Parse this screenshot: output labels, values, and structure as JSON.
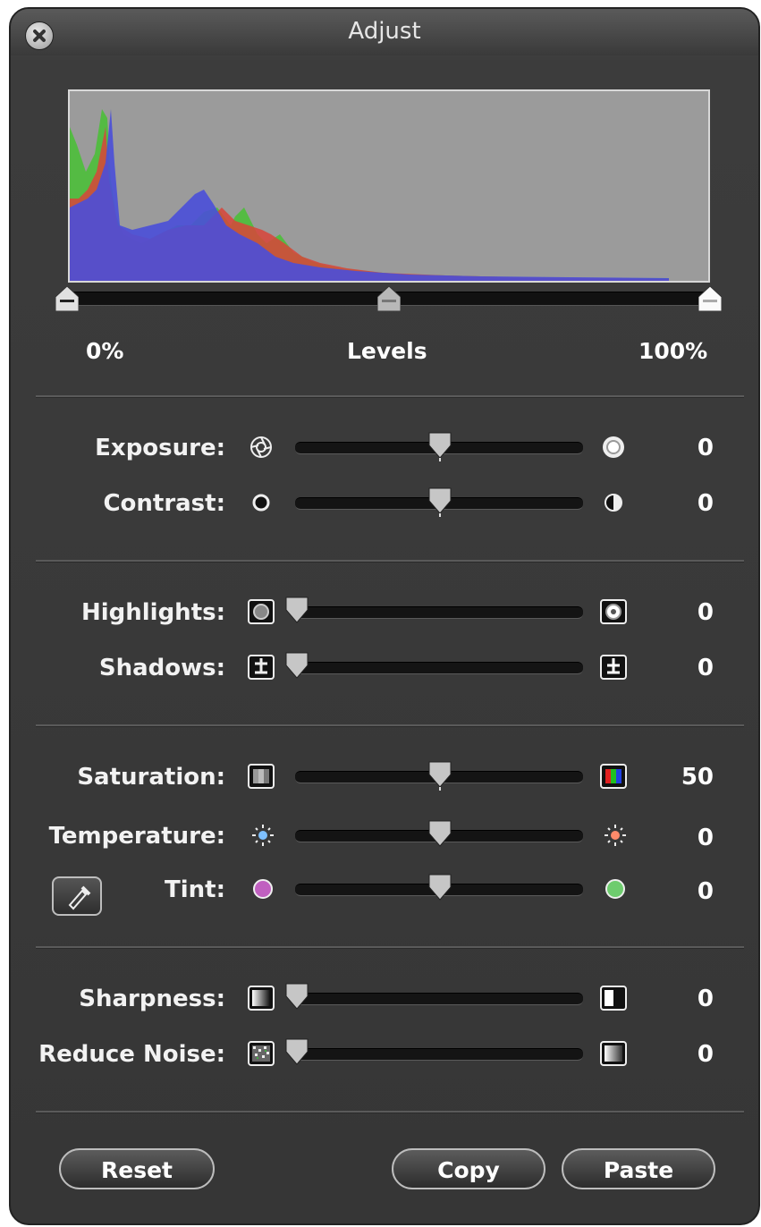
{
  "window": {
    "title": "Adjust"
  },
  "levels": {
    "min_label": "0%",
    "label": "Levels",
    "max_label": "100%",
    "black_point": 0,
    "gray_point": 0.5,
    "white_point": 1
  },
  "sliders": [
    {
      "label": "Exposure:",
      "value": "0",
      "position": 0.5,
      "left_icon": "aperture-icon",
      "right_icon": "bright-aperture-icon"
    },
    {
      "label": "Contrast:",
      "value": "0",
      "position": 0.5,
      "left_icon": "dot-icon",
      "right_icon": "half-circle-icon"
    },
    {
      "label": "Highlights:",
      "value": "0",
      "position": 0,
      "left_icon": "highlights-low-icon",
      "right_icon": "highlights-high-icon"
    },
    {
      "label": "Shadows:",
      "value": "0",
      "position": 0,
      "left_icon": "shadows-low-icon",
      "right_icon": "shadows-high-icon"
    },
    {
      "label": "Saturation:",
      "value": "50",
      "position": 0.5,
      "left_icon": "gray-swatch-icon",
      "right_icon": "rgb-swatch-icon"
    },
    {
      "label": "Temperature:",
      "value": "0",
      "position": 0.5,
      "left_icon": "cool-sun-icon",
      "right_icon": "warm-sun-icon"
    },
    {
      "label": "Tint:",
      "value": "0",
      "position": 0.5,
      "left_icon": "magenta-dot-icon",
      "right_icon": "green-dot-icon"
    },
    {
      "label": "Sharpness:",
      "value": "0",
      "position": 0,
      "left_icon": "soft-edge-icon",
      "right_icon": "sharp-edge-icon"
    },
    {
      "label": "Reduce Noise:",
      "value": "0",
      "position": 0,
      "left_icon": "noisy-icon",
      "right_icon": "smooth-icon"
    }
  ],
  "buttons": {
    "reset": "Reset",
    "copy": "Copy",
    "paste": "Paste"
  },
  "colors": {
    "panel": "#3c3c3c",
    "histogram_bg": "#9b9b9b",
    "red": "#d9443a",
    "green": "#4dbf3a",
    "blue": "#4a4fd9"
  }
}
